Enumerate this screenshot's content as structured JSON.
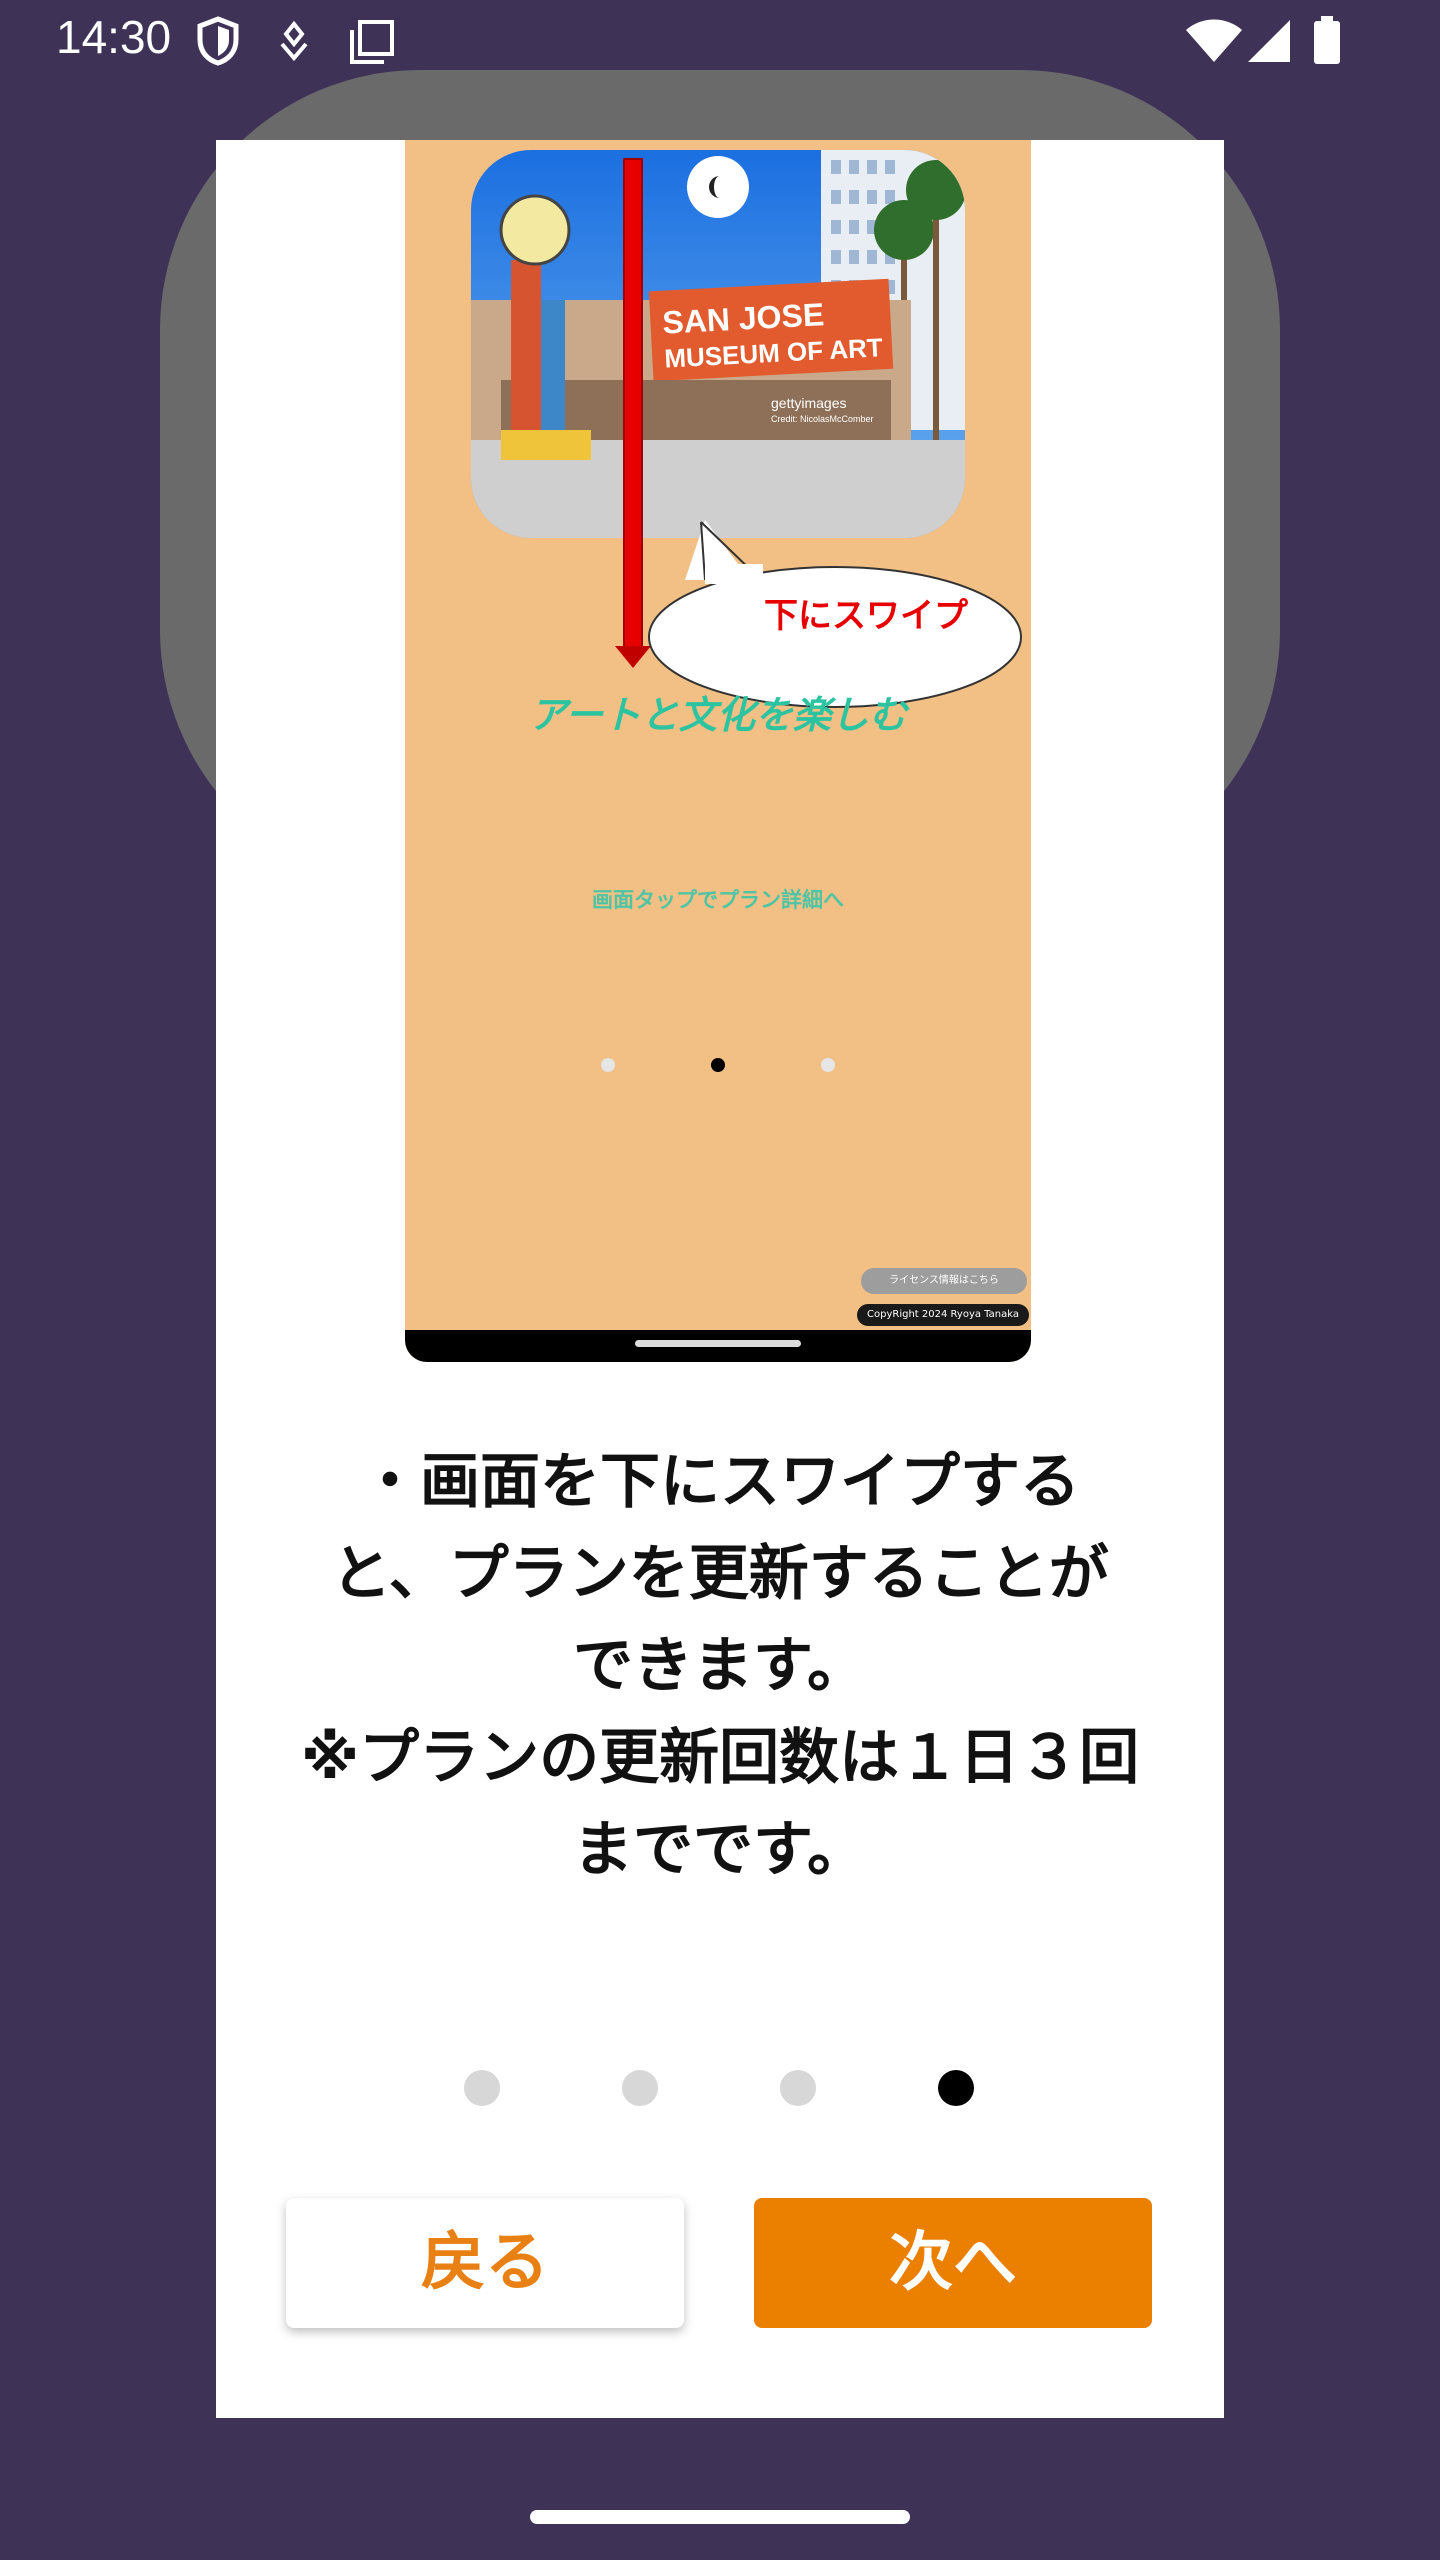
{
  "status_bar": {
    "time": "14:30",
    "left_icons": [
      "shield-icon",
      "debug-icon",
      "screenshot-icon"
    ],
    "right_icons": [
      "wifi-icon",
      "signal-icon",
      "battery-icon"
    ]
  },
  "preview": {
    "swipe_label": "下にスワイプ",
    "title": "アートと文化を楽しむ",
    "tap_hint": "画面タップでプラン詳細へ",
    "license_button": "ライセンス情報はこちら",
    "copyright": "CopyRight 2024 Ryoya Tanaka",
    "photo_text": [
      "SAN JOSE",
      "MUSEUM OF ART",
      "gettyimages",
      "Credit: NicolasMcComber"
    ],
    "dots_count": 3,
    "active_dot": 1
  },
  "description": {
    "lines": [
      "・画面を下にスワイプする",
      "と、プランを更新することが",
      "できます。",
      "※プランの更新回数は１日３回",
      "までです。"
    ]
  },
  "pager": {
    "count": 4,
    "active_index": 3
  },
  "buttons": {
    "back_label": "戻る",
    "next_label": "次へ"
  },
  "colors": {
    "background": "#3f3257",
    "accent": "#ea7f00",
    "preview_bg": "#f2bf84"
  }
}
